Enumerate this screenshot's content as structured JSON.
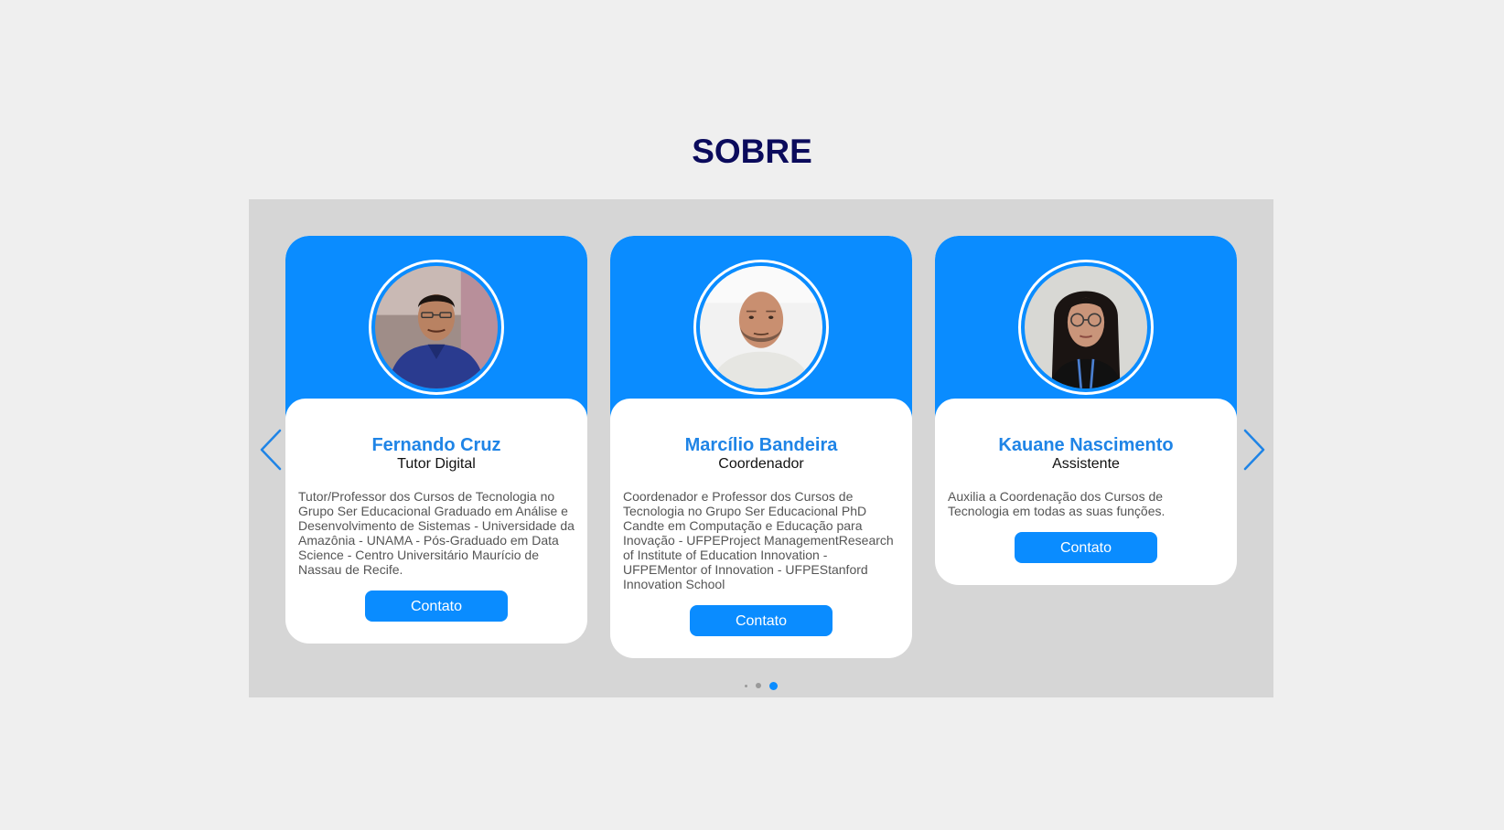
{
  "section": {
    "title": "SOBRE"
  },
  "colors": {
    "accent": "#0a8cff",
    "title": "#0b0b5c",
    "carousel_bg": "#d6d6d6",
    "page_bg": "#efefef"
  },
  "carousel": {
    "prev_icon": "chevron-left-icon",
    "next_icon": "chevron-right-icon",
    "dots_count": 3,
    "active_dot": 3,
    "cards": [
      {
        "name": "Fernando Cruz",
        "role": "Tutor Digital",
        "bio": "Tutor/Professor dos Cursos de Tecnologia no Grupo Ser Educacional Graduado em Análise e Desenvolvimento de Sistemas - Universidade da Amazônia - UNAMA - Pós-Graduado em Data Science - Centro Universitário Maurício de Nassau de Recife.",
        "button": "Contato",
        "photo": "photo-of-man-in-blue-shirt"
      },
      {
        "name": "Marcílio Bandeira",
        "role": "Coordenador",
        "bio": "Coordenador e Professor dos Cursos de Tecnologia no Grupo Ser Educacional PhD Candte em Computação e Educação para Inovação - UFPEProject ManagementResearch of Institute of Education Innovation - UFPEMentor of Innovation - UFPEStanford Innovation School",
        "button": "Contato",
        "photo": "photo-of-bald-man-with-beard"
      },
      {
        "name": "Kauane Nascimento",
        "role": "Assistente",
        "bio": "Auxilia a Coordenação dos Cursos de Tecnologia em todas as suas funções.",
        "button": "Contato",
        "photo": "photo-of-woman-with-glasses"
      }
    ]
  }
}
